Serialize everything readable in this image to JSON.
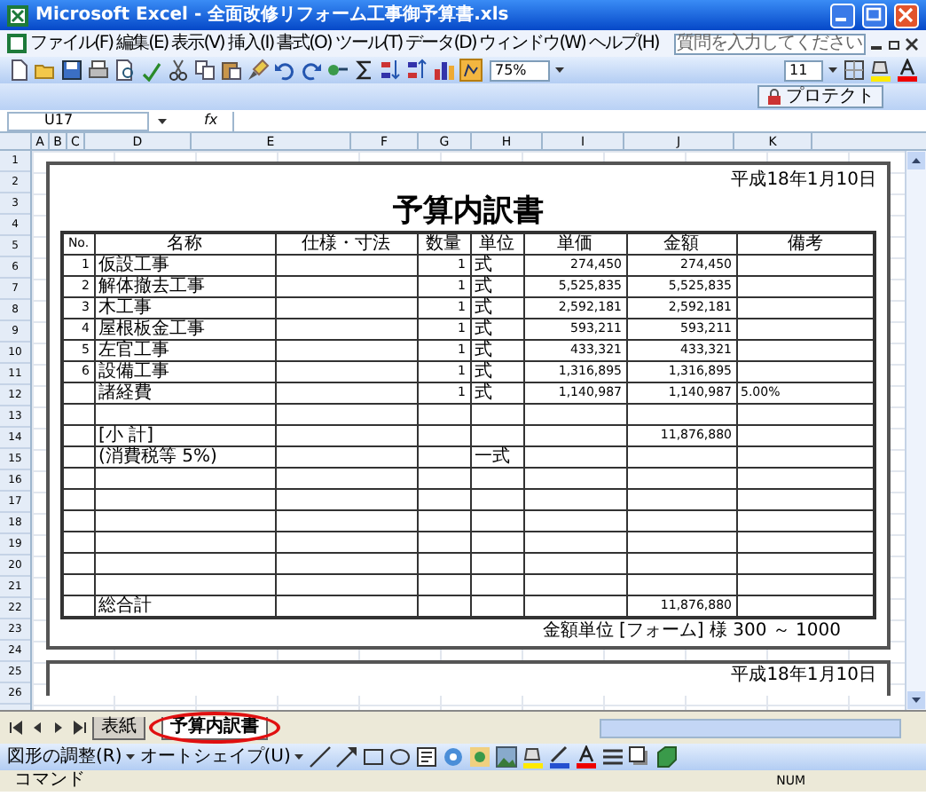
{
  "window": {
    "title": "Microsoft Excel - 全面改修リフォーム工事御予算書.xls"
  },
  "menu_bar": {
    "items": [
      "ファイル(F)",
      "編集(E)",
      "表示(V)",
      "挿入(I)",
      "書式(O)",
      "ツール(T)",
      "データ(D)",
      "ウィンドウ(W)",
      "ヘルプ(H)"
    ],
    "help_placeholder": "質問を入力してください"
  },
  "toolbar": {
    "zoom": "75%",
    "font_size": "11"
  },
  "protect_button": "プロテクト",
  "formula_bar": {
    "name_box": "U17",
    "fx": "fx"
  },
  "column_headers": [
    "A",
    "B",
    "C",
    "D",
    "E",
    "F",
    "G",
    "H",
    "I",
    "J",
    "K"
  ],
  "row_headers": [
    "1",
    "2",
    "3",
    "4",
    "5",
    "6",
    "7",
    "8",
    "9",
    "10",
    "11",
    "12",
    "13",
    "14",
    "15",
    "16",
    "17",
    "18",
    "19",
    "20",
    "21",
    "22",
    "23",
    "24",
    "25",
    "26"
  ],
  "sheet": {
    "date": "平成18年1月10日",
    "title": "予算内訳書",
    "columns": [
      "No.",
      "名称",
      "仕様・寸法",
      "数量",
      "単位",
      "単価",
      "金額",
      "備考"
    ],
    "rows": [
      {
        "no": "1",
        "name": "仮設工事",
        "qty": "1",
        "unit": "式",
        "price": "274,450",
        "amount": "274,450",
        "note": "",
        "gap_before": false
      },
      {
        "no": "2",
        "name": "解体撤去工事",
        "qty": "1",
        "unit": "式",
        "price": "5,525,835",
        "amount": "5,525,835",
        "note": "",
        "gap_before": false
      },
      {
        "no": "3",
        "name": "木工事",
        "qty": "1",
        "unit": "式",
        "price": "2,592,181",
        "amount": "2,592,181",
        "note": "",
        "gap_before": false
      },
      {
        "no": "4",
        "name": "屋根板金工事",
        "qty": "1",
        "unit": "式",
        "price": "593,211",
        "amount": "593,211",
        "note": "",
        "gap_before": false
      },
      {
        "no": "5",
        "name": "左官工事",
        "qty": "1",
        "unit": "式",
        "price": "433,321",
        "amount": "433,321",
        "note": "",
        "gap_before": false
      },
      {
        "no": "6",
        "name": "設備工事",
        "qty": "1",
        "unit": "式",
        "price": "1,316,895",
        "amount": "1,316,895",
        "note": "",
        "gap_before": false
      },
      {
        "no": "",
        "name": "諸経費",
        "qty": "1",
        "unit": "式",
        "price": "1,140,987",
        "amount": "1,140,987",
        "note": "5.00%",
        "gap_before": false
      },
      {
        "no": "",
        "name": "[小 計]",
        "qty": "",
        "unit": "",
        "price": "",
        "amount": "11,876,880",
        "note": "",
        "gap_before": true
      },
      {
        "no": "",
        "name": "(消費税等 5%)",
        "qty": "",
        "unit": "一式",
        "price": "",
        "amount": "",
        "note": "",
        "gap_before": false
      }
    ],
    "total": {
      "label": "総合計",
      "amount": "11,876,880"
    },
    "footer": "金額単位 [フォーム] 様 300 ～ 1000",
    "next_page_date": "平成18年1月10日"
  },
  "sheet_tabs": [
    {
      "label": "表紙",
      "selected": false
    },
    {
      "label": "予算内訳書",
      "selected": true
    }
  ],
  "drawing_toolbar": {
    "items": [
      "図形の調整(R)",
      "オートシェイプ(U)"
    ]
  },
  "status_bar": {
    "left": "コマンド",
    "right": "NUM"
  }
}
